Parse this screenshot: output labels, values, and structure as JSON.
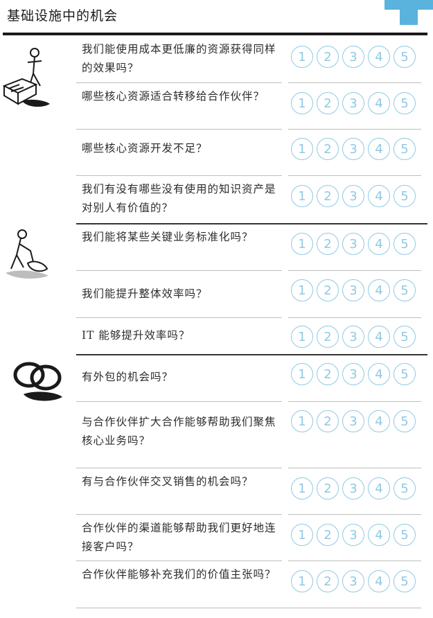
{
  "header": {
    "title": "基础设施中的机会",
    "accent_color": "#5ab3dc"
  },
  "questions": [
    "我们能使用成本更低廉的资源获得同样的效果吗？",
    "哪些核心资源适合转移给合作伙伴？",
    "哪些核心资源开发不足？",
    "我们有没有哪些没有使用的知识资产是对别人有价值的？",
    "我们能将某些关键业务标准化吗？",
    "我们能提升整体效率吗？",
    "IT 能够提升效率吗？",
    "有外包的机会吗？",
    "与合作伙伴扩大合作能够帮助我们聚焦核心业务吗？",
    "有与合作伙伴交叉销售的机会吗？",
    "合作伙伴的渠道能够帮助我们更好地连接客户吗？",
    "合作伙伴能够补充我们的价值主张吗？"
  ],
  "scale": [
    "1",
    "2",
    "3",
    "4",
    "5"
  ],
  "rating_color": "#8fc9e2",
  "icons": [
    "person-with-machine-icon",
    "person-cleaning-icon",
    "linked-rings-icon"
  ]
}
